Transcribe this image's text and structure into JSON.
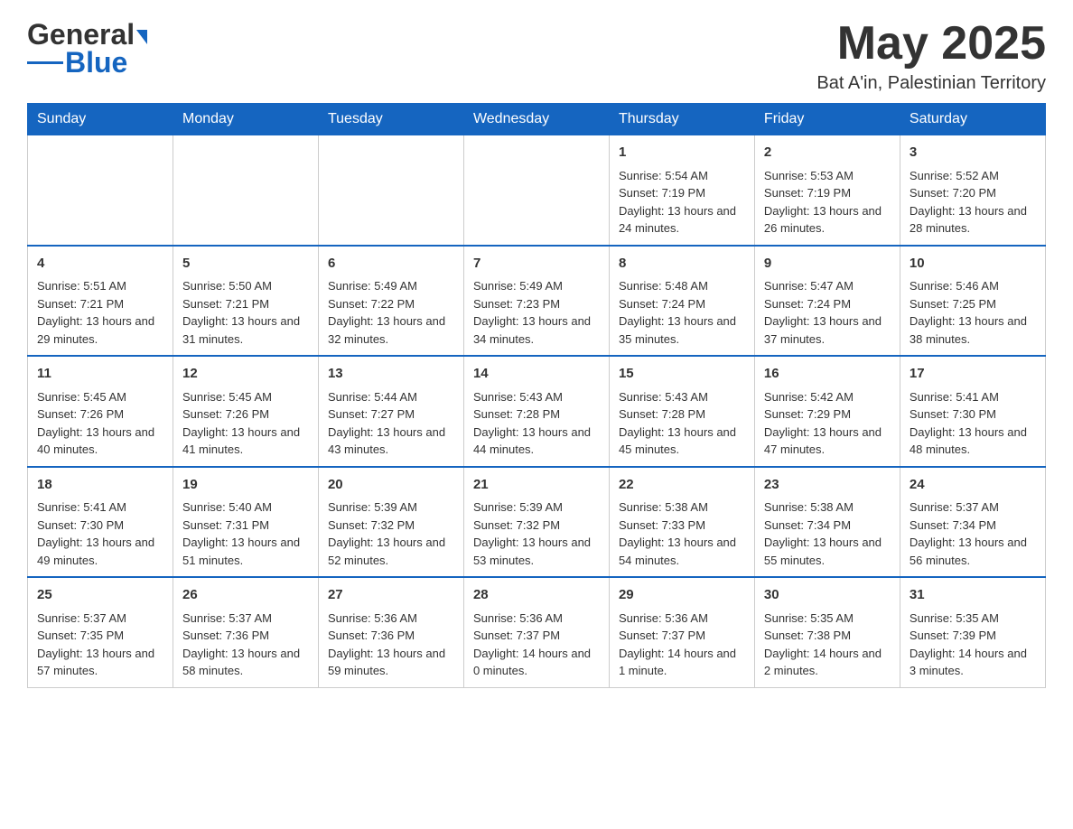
{
  "logo": {
    "text_general": "General",
    "text_blue": "Blue"
  },
  "title": {
    "month_year": "May 2025",
    "location": "Bat A'in, Palestinian Territory"
  },
  "days_of_week": [
    "Sunday",
    "Monday",
    "Tuesday",
    "Wednesday",
    "Thursday",
    "Friday",
    "Saturday"
  ],
  "weeks": [
    {
      "days": [
        {
          "num": "",
          "info": ""
        },
        {
          "num": "",
          "info": ""
        },
        {
          "num": "",
          "info": ""
        },
        {
          "num": "",
          "info": ""
        },
        {
          "num": "1",
          "info": "Sunrise: 5:54 AM\nSunset: 7:19 PM\nDaylight: 13 hours and 24 minutes."
        },
        {
          "num": "2",
          "info": "Sunrise: 5:53 AM\nSunset: 7:19 PM\nDaylight: 13 hours and 26 minutes."
        },
        {
          "num": "3",
          "info": "Sunrise: 5:52 AM\nSunset: 7:20 PM\nDaylight: 13 hours and 28 minutes."
        }
      ]
    },
    {
      "days": [
        {
          "num": "4",
          "info": "Sunrise: 5:51 AM\nSunset: 7:21 PM\nDaylight: 13 hours and 29 minutes."
        },
        {
          "num": "5",
          "info": "Sunrise: 5:50 AM\nSunset: 7:21 PM\nDaylight: 13 hours and 31 minutes."
        },
        {
          "num": "6",
          "info": "Sunrise: 5:49 AM\nSunset: 7:22 PM\nDaylight: 13 hours and 32 minutes."
        },
        {
          "num": "7",
          "info": "Sunrise: 5:49 AM\nSunset: 7:23 PM\nDaylight: 13 hours and 34 minutes."
        },
        {
          "num": "8",
          "info": "Sunrise: 5:48 AM\nSunset: 7:24 PM\nDaylight: 13 hours and 35 minutes."
        },
        {
          "num": "9",
          "info": "Sunrise: 5:47 AM\nSunset: 7:24 PM\nDaylight: 13 hours and 37 minutes."
        },
        {
          "num": "10",
          "info": "Sunrise: 5:46 AM\nSunset: 7:25 PM\nDaylight: 13 hours and 38 minutes."
        }
      ]
    },
    {
      "days": [
        {
          "num": "11",
          "info": "Sunrise: 5:45 AM\nSunset: 7:26 PM\nDaylight: 13 hours and 40 minutes."
        },
        {
          "num": "12",
          "info": "Sunrise: 5:45 AM\nSunset: 7:26 PM\nDaylight: 13 hours and 41 minutes."
        },
        {
          "num": "13",
          "info": "Sunrise: 5:44 AM\nSunset: 7:27 PM\nDaylight: 13 hours and 43 minutes."
        },
        {
          "num": "14",
          "info": "Sunrise: 5:43 AM\nSunset: 7:28 PM\nDaylight: 13 hours and 44 minutes."
        },
        {
          "num": "15",
          "info": "Sunrise: 5:43 AM\nSunset: 7:28 PM\nDaylight: 13 hours and 45 minutes."
        },
        {
          "num": "16",
          "info": "Sunrise: 5:42 AM\nSunset: 7:29 PM\nDaylight: 13 hours and 47 minutes."
        },
        {
          "num": "17",
          "info": "Sunrise: 5:41 AM\nSunset: 7:30 PM\nDaylight: 13 hours and 48 minutes."
        }
      ]
    },
    {
      "days": [
        {
          "num": "18",
          "info": "Sunrise: 5:41 AM\nSunset: 7:30 PM\nDaylight: 13 hours and 49 minutes."
        },
        {
          "num": "19",
          "info": "Sunrise: 5:40 AM\nSunset: 7:31 PM\nDaylight: 13 hours and 51 minutes."
        },
        {
          "num": "20",
          "info": "Sunrise: 5:39 AM\nSunset: 7:32 PM\nDaylight: 13 hours and 52 minutes."
        },
        {
          "num": "21",
          "info": "Sunrise: 5:39 AM\nSunset: 7:32 PM\nDaylight: 13 hours and 53 minutes."
        },
        {
          "num": "22",
          "info": "Sunrise: 5:38 AM\nSunset: 7:33 PM\nDaylight: 13 hours and 54 minutes."
        },
        {
          "num": "23",
          "info": "Sunrise: 5:38 AM\nSunset: 7:34 PM\nDaylight: 13 hours and 55 minutes."
        },
        {
          "num": "24",
          "info": "Sunrise: 5:37 AM\nSunset: 7:34 PM\nDaylight: 13 hours and 56 minutes."
        }
      ]
    },
    {
      "days": [
        {
          "num": "25",
          "info": "Sunrise: 5:37 AM\nSunset: 7:35 PM\nDaylight: 13 hours and 57 minutes."
        },
        {
          "num": "26",
          "info": "Sunrise: 5:37 AM\nSunset: 7:36 PM\nDaylight: 13 hours and 58 minutes."
        },
        {
          "num": "27",
          "info": "Sunrise: 5:36 AM\nSunset: 7:36 PM\nDaylight: 13 hours and 59 minutes."
        },
        {
          "num": "28",
          "info": "Sunrise: 5:36 AM\nSunset: 7:37 PM\nDaylight: 14 hours and 0 minutes."
        },
        {
          "num": "29",
          "info": "Sunrise: 5:36 AM\nSunset: 7:37 PM\nDaylight: 14 hours and 1 minute."
        },
        {
          "num": "30",
          "info": "Sunrise: 5:35 AM\nSunset: 7:38 PM\nDaylight: 14 hours and 2 minutes."
        },
        {
          "num": "31",
          "info": "Sunrise: 5:35 AM\nSunset: 7:39 PM\nDaylight: 14 hours and 3 minutes."
        }
      ]
    }
  ]
}
